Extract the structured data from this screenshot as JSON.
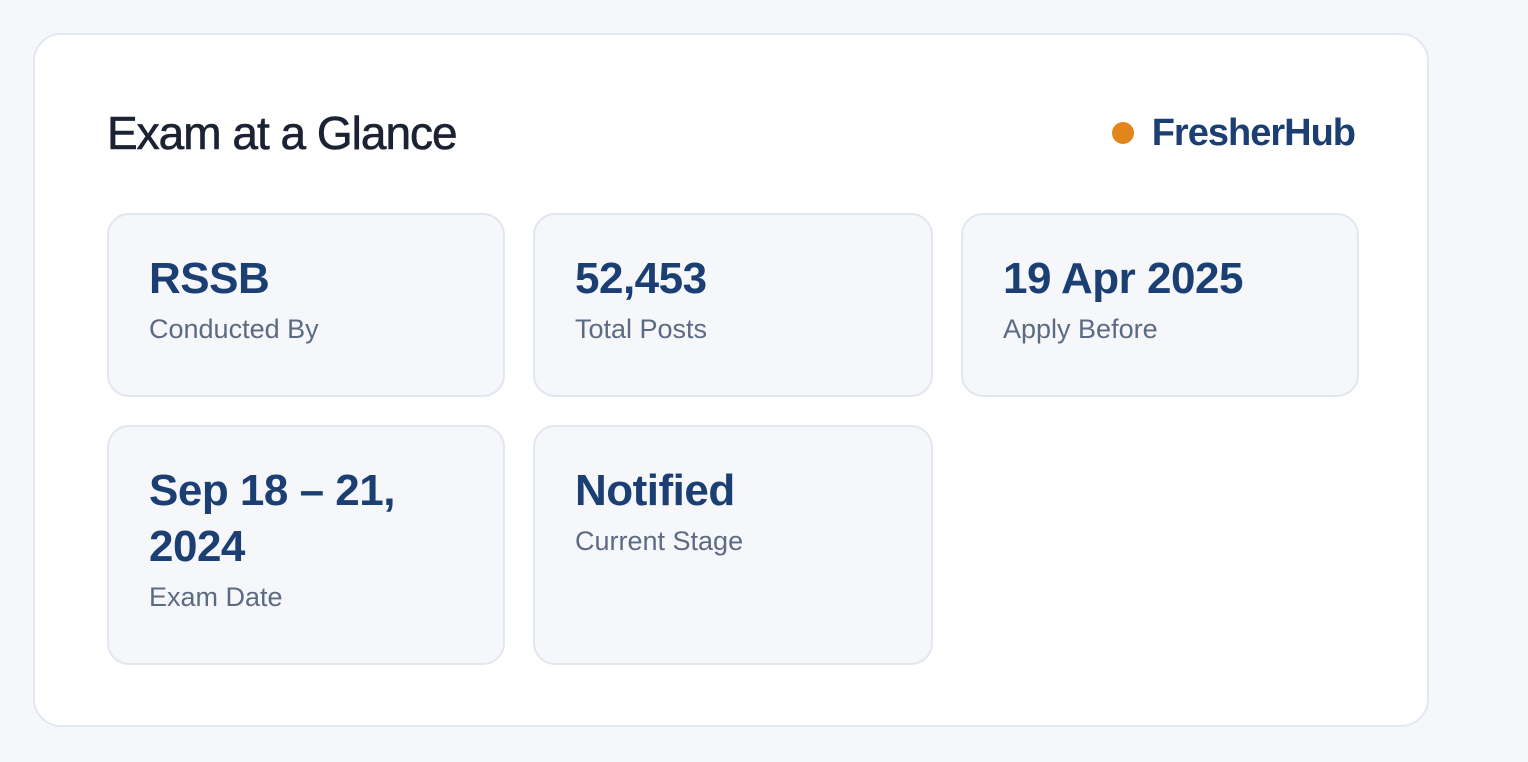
{
  "card": {
    "title": "Exam at a Glance",
    "brand": {
      "name": "FresherHub",
      "dot_color": "#e2861b",
      "color": "#1b3f73"
    }
  },
  "tiles": [
    {
      "value": "RSSB",
      "label": "Conducted By"
    },
    {
      "value": "52,453",
      "label": "Total Posts"
    },
    {
      "value": "19 Apr 2025",
      "label": "Apply Before"
    },
    {
      "value": "Sep 18 – 21, 2024",
      "label": "Exam Date"
    },
    {
      "value": "Notified",
      "label": "Current Stage"
    }
  ],
  "colors": {
    "accent": "#1b3f73",
    "label": "#5d6b82",
    "tile_background": "#f5f7fb"
  }
}
